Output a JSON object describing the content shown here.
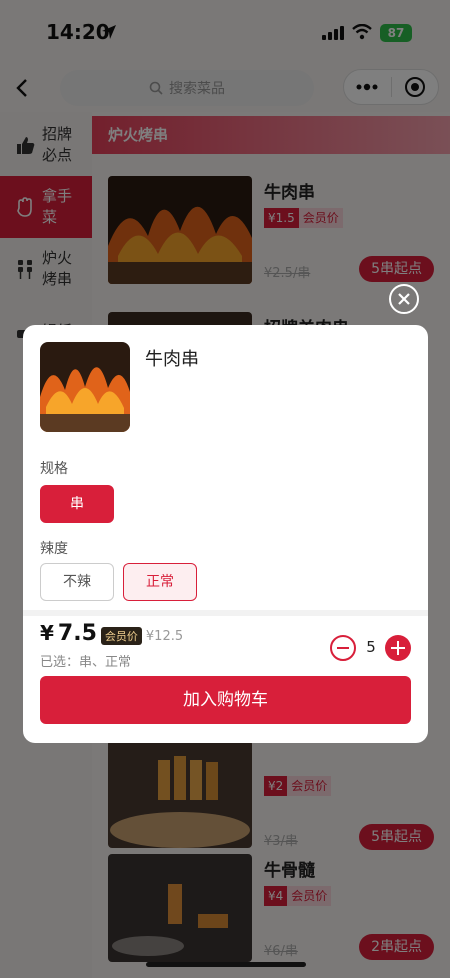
{
  "status": {
    "time": "14:20",
    "battery": "87"
  },
  "nav": {
    "search_placeholder": "搜索菜品"
  },
  "sidebar": {
    "items": [
      {
        "label": "招牌必点",
        "icon": "thumbs-up-icon"
      },
      {
        "label": "拿手菜",
        "icon": "hand-wave-icon"
      },
      {
        "label": "炉火烤串",
        "icon": "skewer-icon"
      },
      {
        "label": "锡纸",
        "icon": "foil-icon"
      }
    ]
  },
  "content": {
    "category_title": "炉火烤串",
    "products": [
      {
        "name": "牛肉串",
        "price": "¥1.5",
        "member": "会员价",
        "orig": "¥2.5/串",
        "min": "5串起点"
      },
      {
        "name": "招牌羊肉串"
      },
      {
        "price": "¥2",
        "member": "会员价",
        "orig": "¥3/串",
        "min": "5串起点"
      },
      {
        "name": "牛骨髓",
        "price": "¥4",
        "member": "会员价",
        "orig": "¥6/串",
        "min": "2串起点"
      }
    ]
  },
  "modal": {
    "title": "牛肉串",
    "spec_label": "规格",
    "spec_options": [
      "串"
    ],
    "spice_label": "辣度",
    "spice_options": [
      "不辣",
      "正常"
    ],
    "price_currency": "¥",
    "price_value": "7.5",
    "member_badge": "会员价",
    "orig_price": "¥12.5",
    "selected_text": "已选：串、正常",
    "quantity": "5",
    "add_to_cart": "加入购物车"
  },
  "colors": {
    "accent": "#d81f3a"
  }
}
